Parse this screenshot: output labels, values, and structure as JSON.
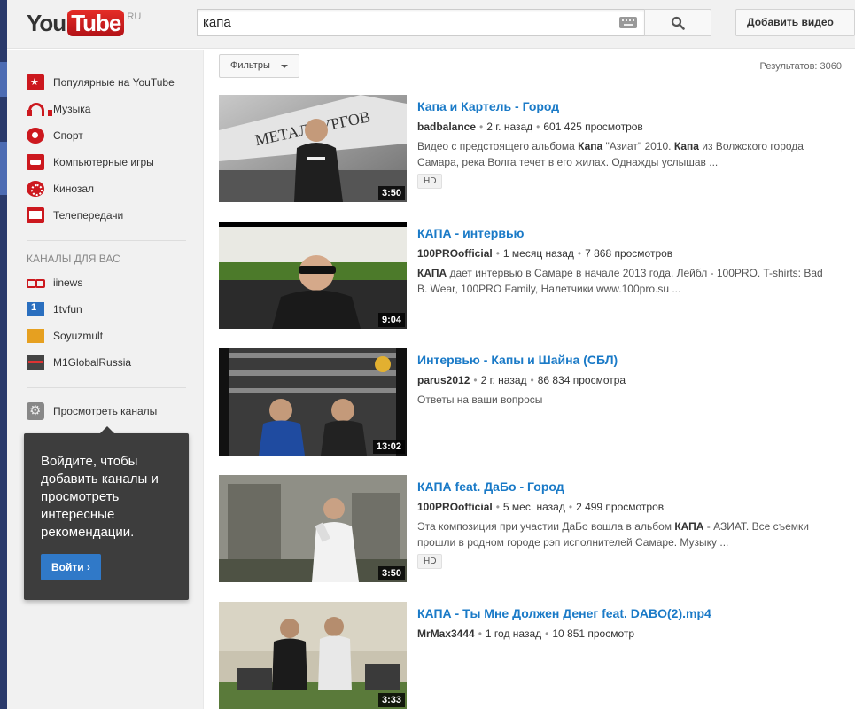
{
  "header": {
    "logo_you": "You",
    "logo_tube": "Tube",
    "logo_region": "RU",
    "search_value": "капа",
    "upload_label": "Добавить видео"
  },
  "sidebar": {
    "guide_items": [
      {
        "label": "Популярные на YouTube",
        "icon": "popular-star-icon"
      },
      {
        "label": "Музыка",
        "icon": "headphones-icon"
      },
      {
        "label": "Спорт",
        "icon": "sport-ball-icon"
      },
      {
        "label": "Компьютерные игры",
        "icon": "gamepad-icon"
      },
      {
        "label": "Кинозал",
        "icon": "film-reel-icon"
      },
      {
        "label": "Телепередачи",
        "icon": "tv-icon"
      }
    ],
    "channels_title": "КАНАЛЫ ДЛЯ ВАС",
    "channels": [
      {
        "label": "iinews"
      },
      {
        "label": "1tvfun"
      },
      {
        "label": "Soyuzmult"
      },
      {
        "label": "M1GlobalRussia"
      }
    ],
    "browse_channels": "Просмотреть каналы"
  },
  "signin_popup": {
    "text": "Войдите, чтобы добавить каналы и просмотреть интересные рекомендации.",
    "button": "Войти ›"
  },
  "filters": {
    "label": "Фильтры",
    "results_count": "Результатов: 3060"
  },
  "results": [
    {
      "title": "Капа и Картель - Город",
      "user": "badbalance",
      "age": "2 г. назад",
      "views": "601 425 просмотров",
      "desc_html_parts": [
        "Видео с предстоящего альбома ",
        "Капа",
        " \"Азиат\" 2010. ",
        "Капа",
        " из Волжского города Самара, река Волга течет в его жилах. Однажды услышав ..."
      ],
      "hd": "HD",
      "duration": "3:50"
    },
    {
      "title": "КАПА - интервью",
      "user": "100PROofficial",
      "age": "1 месяц назад",
      "views": "7 868 просмотров",
      "desc_html_parts": [
        "",
        "КАПА",
        " дает интервью в Самаре в начале 2013 года. Лейбл - 100PRO. T-shirts: Bad B. Wear, 100PRO Family, Налетчики www.100pro.su ..."
      ],
      "hd": "",
      "duration": "9:04"
    },
    {
      "title": "Интервью - Капы и Шайна (СБЛ)",
      "user": "parus2012",
      "age": "2 г. назад",
      "views": "86 834 просмотра",
      "desc_html_parts": [
        "Ответы на ваши вопросы"
      ],
      "hd": "",
      "duration": "13:02"
    },
    {
      "title": "КАПА feat. ДаБо - Город",
      "user": "100PROofficial",
      "age": "5 мес. назад",
      "views": "2 499 просмотров",
      "desc_html_parts": [
        "Эта композиция при участии ДаБо вошла в альбом ",
        "КАПА",
        " - АЗИАТ. Все съемки прошли в родном городе рэп исполнителей Самаре. Музыку ..."
      ],
      "hd": "HD",
      "duration": "3:50"
    },
    {
      "title": "КАПА - Ты Мне Должен Денег feat. DABO(2).mp4",
      "user": "MrMax3444",
      "age": "1 год назад",
      "views": "10 851 просмотр",
      "desc_html_parts": [],
      "hd": "",
      "duration": "3:33"
    }
  ]
}
